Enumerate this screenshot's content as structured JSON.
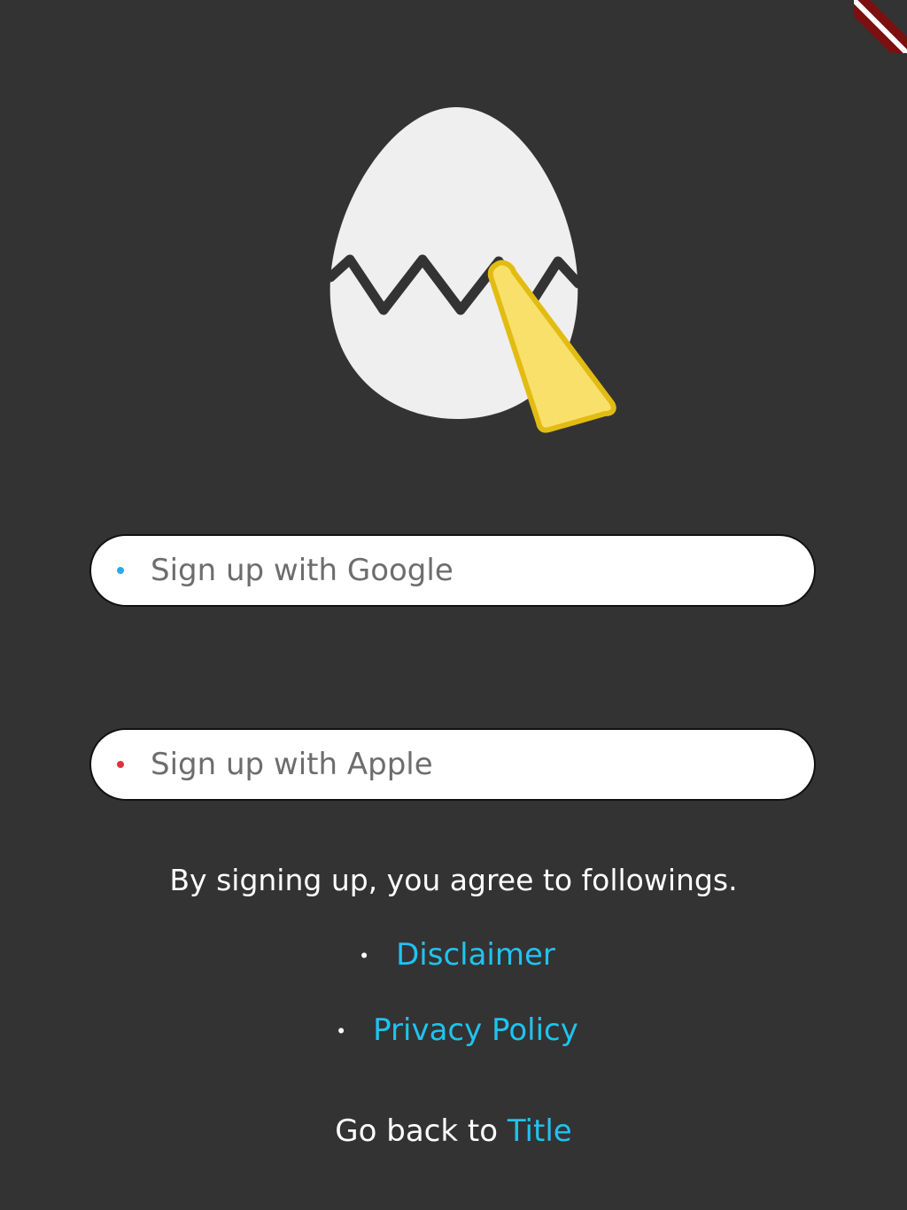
{
  "logo": {
    "icon": "cracked-egg-with-beak-icon"
  },
  "signup": {
    "google": {
      "label": "Sign up with Google",
      "dot_color": "#2aa8f0"
    },
    "apple": {
      "label": "Sign up with Apple",
      "dot_color": "#e03040"
    }
  },
  "agreement": {
    "text": "By signing up, you agree to followings.",
    "bullet": "・",
    "links": {
      "disclaimer": "Disclaimer",
      "privacy_policy": "Privacy Policy"
    }
  },
  "back": {
    "prefix": "Go back to ",
    "link": "Title"
  },
  "colors": {
    "background": "#333333",
    "link": "#1fc3f0",
    "egg": "#efefef",
    "beak": "#f9e06a",
    "beak_outline": "#e2bc12",
    "crack": "#333333"
  }
}
